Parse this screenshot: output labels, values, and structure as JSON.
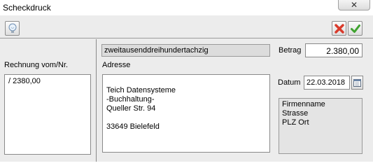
{
  "window": {
    "title": "Scheckdruck"
  },
  "toolbar": {
    "tip_icon": "lightbulb-icon",
    "cancel_icon": "red-x-icon",
    "ok_icon": "green-check-icon"
  },
  "left": {
    "label": "Rechnung vom/Nr.",
    "items": [
      "/ 2380,00"
    ]
  },
  "cheque": {
    "amount_words": "zweitausenddreihundertachzig",
    "betrag_label": "Betrag",
    "betrag_value": "2.380,00",
    "adresse_label": "Adresse",
    "address": "Teich Datensysteme\n-Buchhaltung-\nQueller Str. 94\n\n33649 Bielefeld",
    "datum_label": "Datum",
    "datum_value": "22.03.2018",
    "sender_placeholder": "Firmenname\nStrasse\nPLZ Ort"
  },
  "colors": {
    "cancel": "#d93a2b",
    "ok": "#3fa32f"
  }
}
